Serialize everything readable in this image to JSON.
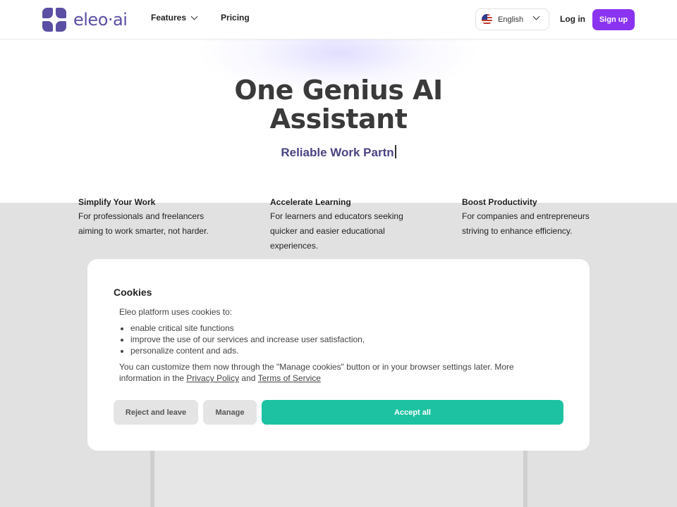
{
  "header": {
    "logo_text": "eleo·ai",
    "nav": [
      {
        "label": "Features",
        "has_dropdown": true
      },
      {
        "label": "Pricing",
        "has_dropdown": false
      }
    ],
    "language": {
      "label": "English",
      "flag_icon": "us-flag-icon"
    },
    "login_label": "Log in",
    "signup_label": "Sign up"
  },
  "hero": {
    "title_line1": "One Genius AI",
    "title_line2": "Assistant",
    "subtitle": "Reliable Work Partn"
  },
  "features": [
    {
      "title": "Simplify Your Work",
      "desc_line1": "For professionals and freelancers",
      "desc_line2": "aiming to work smarter, not harder.",
      "desc_line3": ""
    },
    {
      "title": "Accelerate Learning",
      "desc_line1": "For learners and educators seeking",
      "desc_line2": "quicker and easier educational",
      "desc_line3": "experiences."
    },
    {
      "title": "Boost Productivity",
      "desc_line1": "For companies and entrepreneurs",
      "desc_line2": "striving to enhance efficiency.",
      "desc_line3": ""
    }
  ],
  "cookies": {
    "title": "Cookies",
    "intro": "Eleo platform uses cookies to:",
    "items": [
      "enable critical site functions",
      "improve the use of our services and increase user satisfaction,",
      "personalize content and ads."
    ],
    "policy_text": "You can customize them now through the \"Manage cookies\" button or in your browser settings later. More information in the ",
    "privacy_link": "Privacy Policy",
    "and_text": " and ",
    "terms_link": "Terms of Service",
    "reject_label": "Reject and leave",
    "manage_label": "Manage",
    "accept_label": "Accept all"
  },
  "colors": {
    "brand": "#5a4fa3",
    "signup_bg": "#8a33f0",
    "accept_bg": "#1dc2a2",
    "overlay": "#e1e1e1"
  }
}
